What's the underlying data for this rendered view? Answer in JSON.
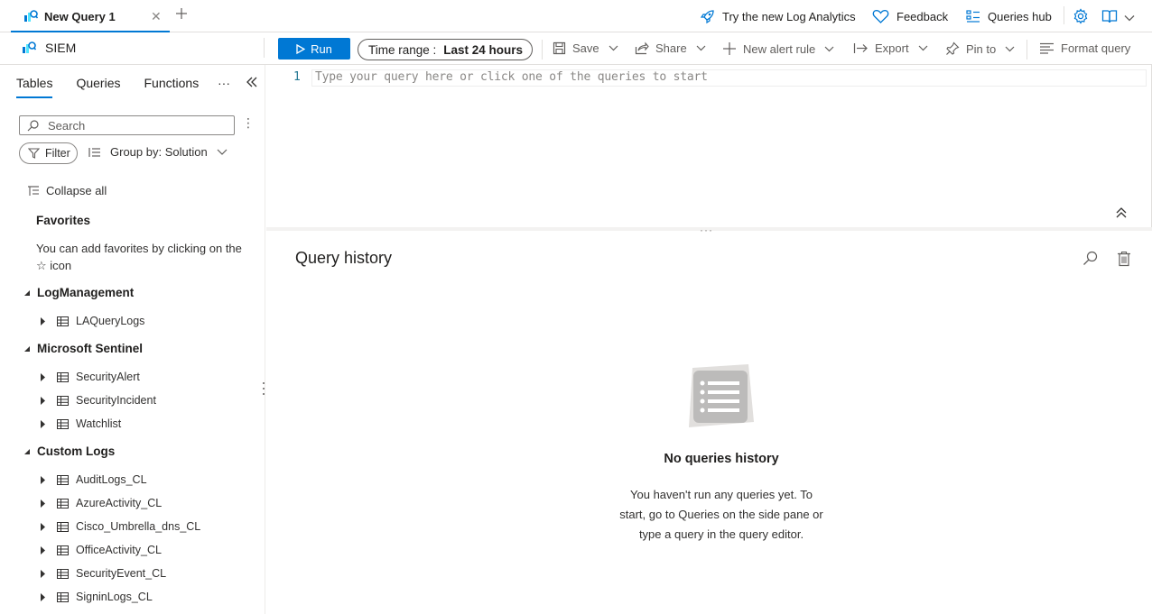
{
  "tabbar": {
    "query_tab_label": "New Query 1",
    "try_analytics": "Try the new Log Analytics",
    "feedback": "Feedback",
    "queries_hub": "Queries hub"
  },
  "toolbar": {
    "workspace": "SIEM",
    "run": "Run",
    "time_range_label": "Time range :",
    "time_range_value": "Last 24 hours",
    "save": "Save",
    "share": "Share",
    "new_alert_rule": "New alert rule",
    "export": "Export",
    "pin_to": "Pin to",
    "format_query": "Format query"
  },
  "sidebar": {
    "tabs": [
      {
        "label": "Tables",
        "active": true
      },
      {
        "label": "Queries",
        "active": false
      },
      {
        "label": "Functions",
        "active": false
      }
    ],
    "more": "···",
    "search_placeholder": "Search",
    "filter": "Filter",
    "group_by": "Group by: Solution",
    "collapse_all": "Collapse all",
    "favorites_title": "Favorites",
    "favorites_desc": "You can add favorites by clicking on the ☆ icon",
    "groups": [
      {
        "name": "LogManagement",
        "tables": [
          "LAQueryLogs"
        ]
      },
      {
        "name": "Microsoft Sentinel",
        "tables": [
          "SecurityAlert",
          "SecurityIncident",
          "Watchlist"
        ]
      },
      {
        "name": "Custom Logs",
        "tables": [
          "AuditLogs_CL",
          "AzureActivity_CL",
          "Cisco_Umbrella_dns_CL",
          "OfficeActivity_CL",
          "SecurityEvent_CL",
          "SigninLogs_CL"
        ]
      }
    ]
  },
  "editor": {
    "line_number": "1",
    "placeholder": "Type your query here or click one of the queries to start"
  },
  "history": {
    "title": "Query history",
    "empty_title": "No queries history",
    "empty_desc": "You haven't run any queries yet. To start, go to Queries on the side pane or type a query in the query editor."
  },
  "colors": {
    "accent": "#0078d4",
    "text": "#323130",
    "border": "#e1dfdd"
  }
}
